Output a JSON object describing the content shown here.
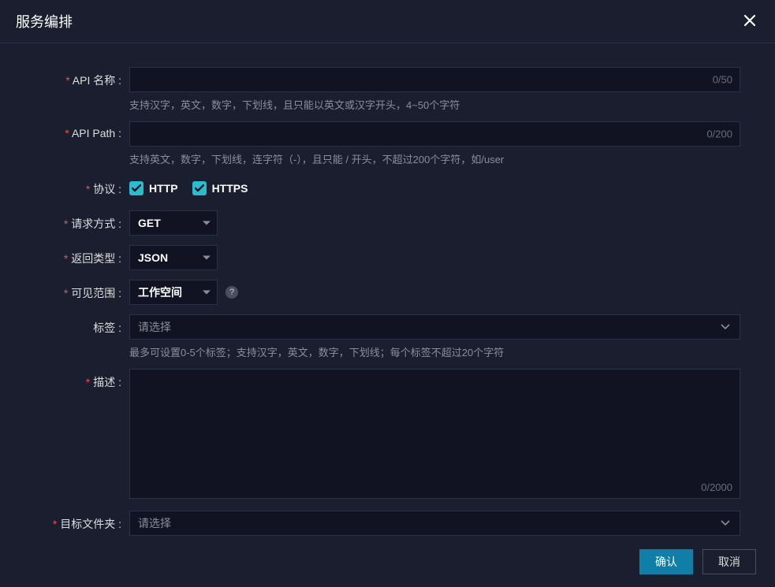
{
  "modal": {
    "title": "服务编排"
  },
  "fields": {
    "apiName": {
      "label": "API 名称 :",
      "counter": "0/50",
      "helper": "支持汉字，英文，数字，下划线，且只能以英文或汉字开头，4~50个字符"
    },
    "apiPath": {
      "label": "API Path :",
      "counter": "0/200",
      "helper": "支持英文，数字，下划线，连字符（-），且只能 / 开头，不超过200个字符，如/user"
    },
    "protocol": {
      "label": "协议 :",
      "http": "HTTP",
      "https": "HTTPS"
    },
    "method": {
      "label": "请求方式 :",
      "value": "GET"
    },
    "returnType": {
      "label": "返回类型 :",
      "value": "JSON"
    },
    "visibility": {
      "label": "可见范围 :",
      "value": "工作空间"
    },
    "tags": {
      "label": "标签 :",
      "placeholder": "请选择",
      "helper": "最多可设置0-5个标签；支持汉字，英文，数字，下划线；每个标签不超过20个字符"
    },
    "description": {
      "label": "描述 :",
      "counter": "0/2000"
    },
    "targetFolder": {
      "label": "目标文件夹 :",
      "placeholder": "请选择"
    }
  },
  "buttons": {
    "confirm": "确认",
    "cancel": "取消"
  },
  "icons": {
    "help": "?"
  }
}
